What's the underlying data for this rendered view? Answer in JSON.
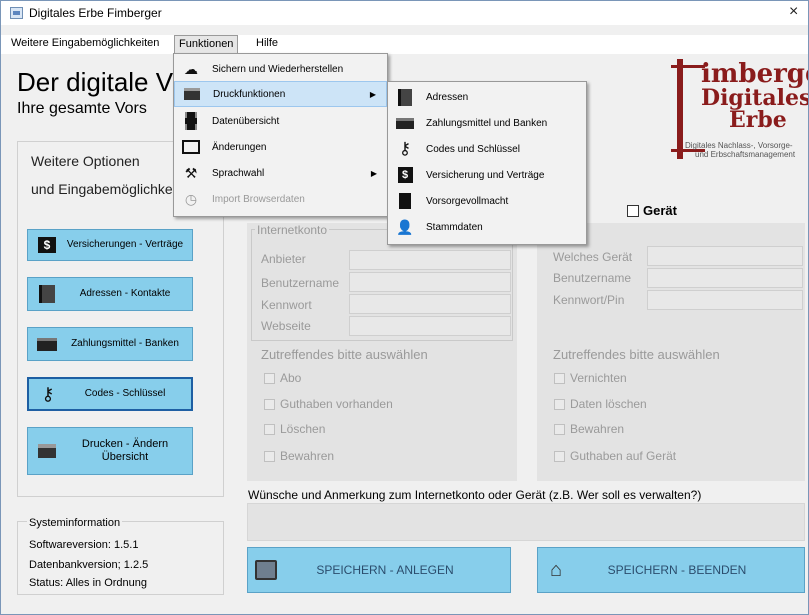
{
  "window": {
    "title": "Digitales Erbe Fimberger",
    "close": "×"
  },
  "menubar": {
    "items": [
      "Weitere Eingabemöglichkeiten",
      "Funktionen",
      "Hilfe"
    ]
  },
  "header": {
    "title": "Der digitale V",
    "subtitle": "Ihre gesamte Vors"
  },
  "logo": {
    "line1": "imberger",
    "line2": "Digitales",
    "line3": "Erbe",
    "sub1": "Digitales Nachlass-, Vorsorge-",
    "sub2": "und Erbschaftsmanagement"
  },
  "options": {
    "title1": "Weitere Optionen",
    "title2": "und Eingabemöglichke"
  },
  "nav_buttons": [
    {
      "label": "Versicherungen - Verträge",
      "icon": "dollar-icon"
    },
    {
      "label": "Adressen - Kontakte",
      "icon": "address-book-icon"
    },
    {
      "label": "Zahlungsmittel - Banken",
      "icon": "card-icon"
    },
    {
      "label": "Codes - Schlüssel",
      "icon": "key-icon"
    },
    {
      "label": "Drucken - Ändern Übersicht",
      "icon": "printer-icon"
    }
  ],
  "sysinfo": {
    "title": "Systeminformation",
    "software": "Softwareversion:   1.5.1",
    "database": "Datenbankversion;   1.2.5",
    "status": "Status: Alles in Ordnung"
  },
  "geraet_checkbox": {
    "label": "Gerät",
    "checked": false
  },
  "internet_panel": {
    "group_label": "Internetkonto",
    "fields": [
      "Anbieter",
      "Benutzername",
      "Kennwort",
      "Webseite"
    ],
    "section": "Zutreffendes bitte auswählen",
    "checks": [
      "Abo",
      "Guthaben vorhanden",
      "Löschen",
      "Bewahren"
    ]
  },
  "device_panel": {
    "fields": [
      "Welches Gerät",
      "Benutzername",
      "Kennwort/Pin"
    ],
    "section": "Zutreffendes bitte auswählen",
    "checks": [
      "Vernichten",
      "Daten löschen",
      "Bewahren",
      "Guthaben auf Gerät"
    ]
  },
  "wunsch": {
    "label": "Wünsche und Anmerkung zum Internetkonto oder Gerät (z.B. Wer soll es verwalten?)",
    "value": ""
  },
  "actions": {
    "save_new": "SPEICHERN - ANLEGEN",
    "save_exit": "SPEICHERN - BEENDEN"
  },
  "menu_funktionen": [
    {
      "label": "Sichern und Wiederherstellen",
      "icon": "cloud-icon"
    },
    {
      "label": "Druckfunktionen",
      "icon": "printer-icon",
      "submenu": true,
      "highlighted": true
    },
    {
      "label": "Datenübersicht",
      "icon": "film-icon"
    },
    {
      "label": "Änderungen",
      "icon": "edit-icon"
    },
    {
      "label": "Sprachwahl",
      "icon": "tools-icon",
      "submenu": true
    },
    {
      "label": "Import Browserdaten",
      "icon": "clock-icon",
      "disabled": true
    }
  ],
  "menu_druck": [
    {
      "label": "Adressen",
      "icon": "address-book-icon"
    },
    {
      "label": "Zahlungsmittel und Banken",
      "icon": "card-icon"
    },
    {
      "label": "Codes und Schlüssel",
      "icon": "key-icon"
    },
    {
      "label": "Versicherung und Verträge",
      "icon": "dollar-icon"
    },
    {
      "label": "Vorsorgevollmacht",
      "icon": "document-icon"
    },
    {
      "label": "Stammdaten",
      "icon": "person-icon"
    }
  ],
  "colors": {
    "button_bg": "#87ceeb",
    "logo": "#8a1c1c",
    "menu_highlight": "#cde4f7"
  }
}
